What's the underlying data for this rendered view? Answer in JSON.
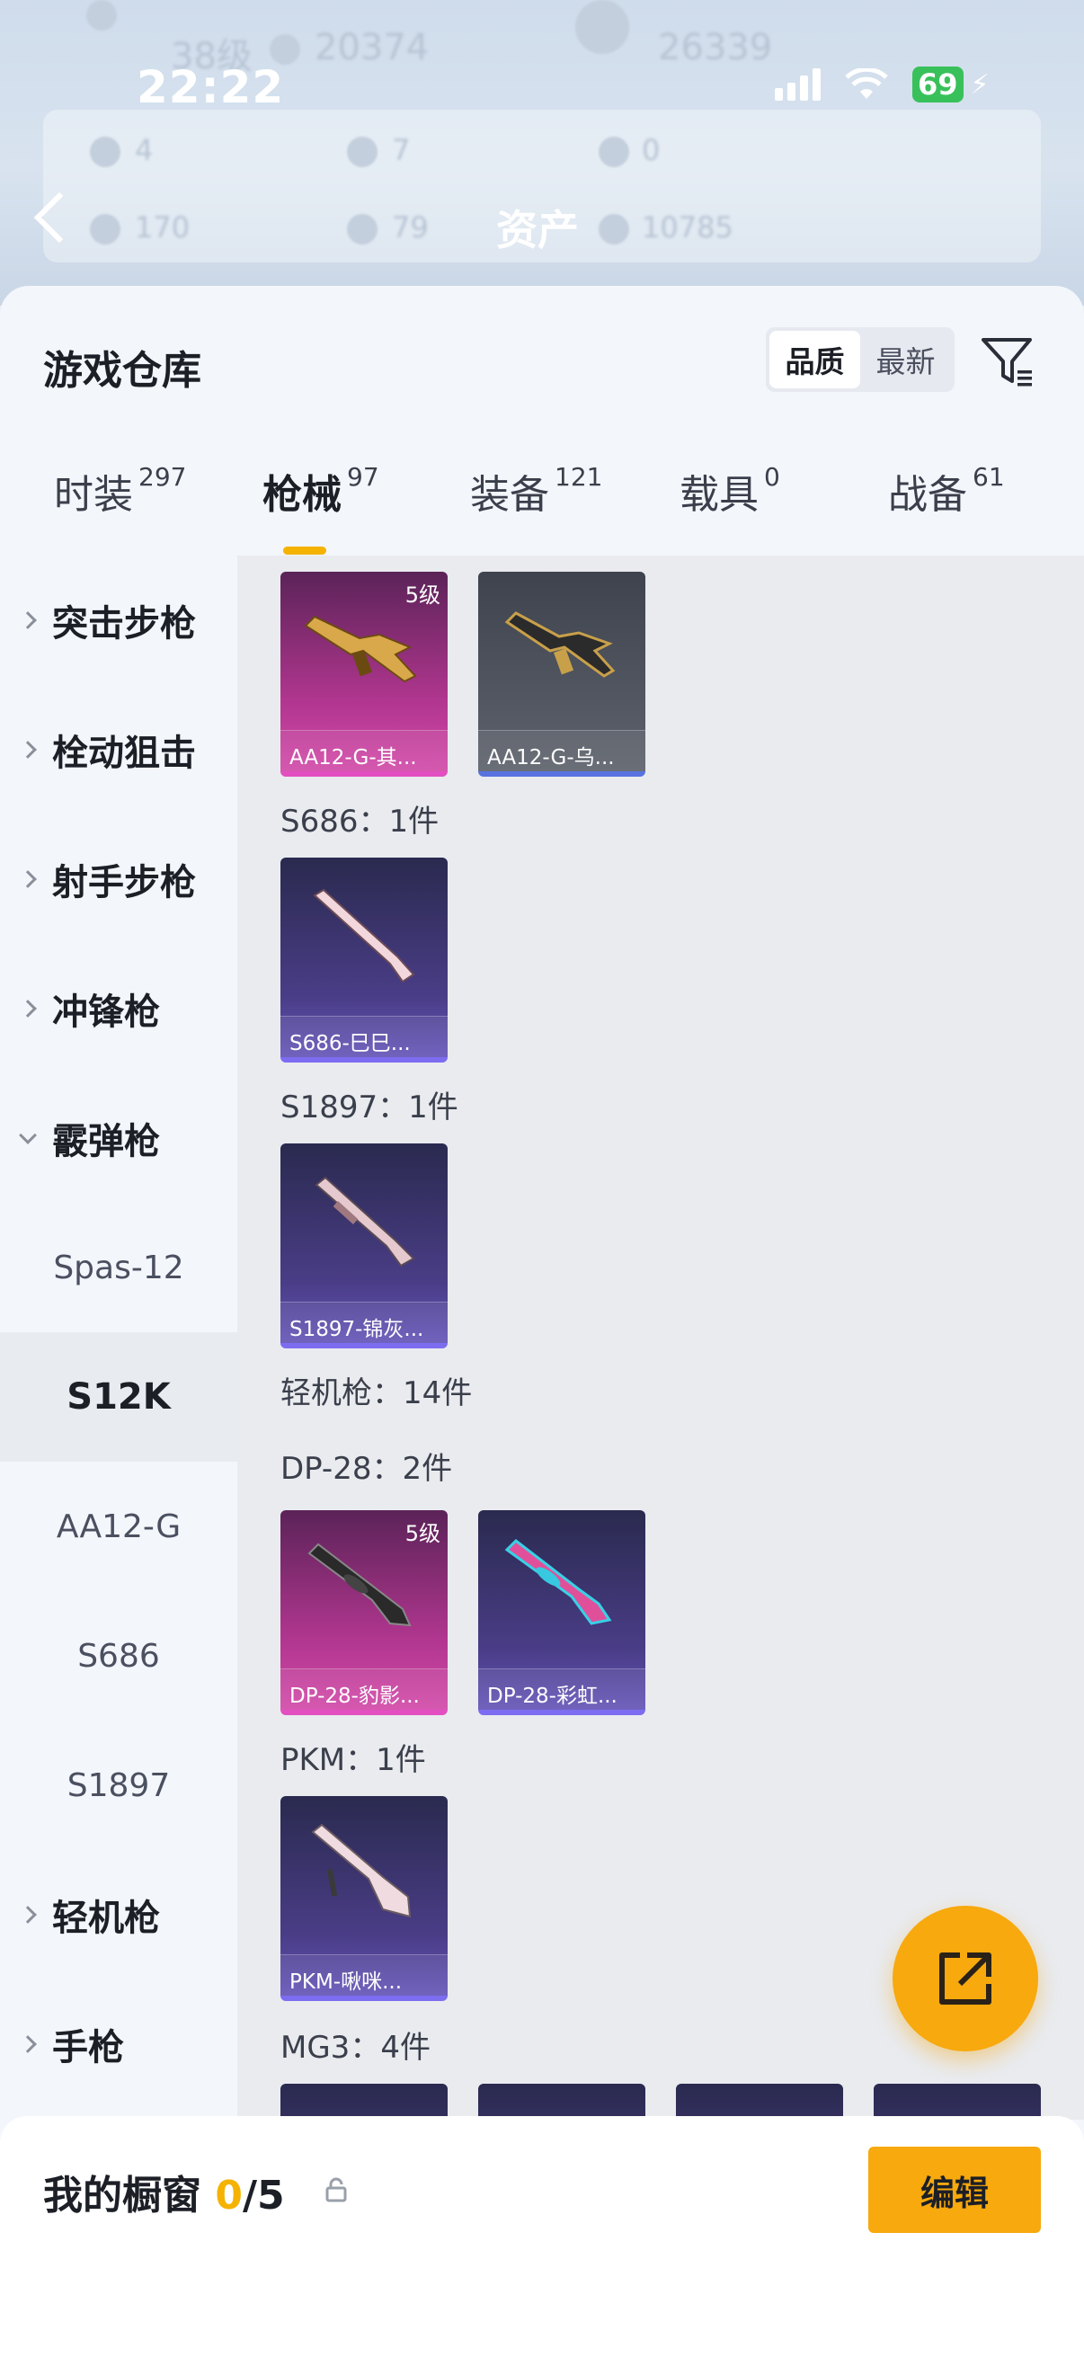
{
  "status_bar": {
    "time": "22:22",
    "battery": "69"
  },
  "header": {
    "title": "资产",
    "bg_stats": [
      "38级",
      "20374",
      "26339",
      "4",
      "7",
      "0",
      "170",
      "79",
      "10785"
    ]
  },
  "warehouse": {
    "title": "游戏仓库",
    "sort_options": [
      "品质",
      "最新"
    ],
    "active_sort": "品质",
    "tabs": [
      {
        "label": "时装",
        "count": "297"
      },
      {
        "label": "枪械",
        "count": "97"
      },
      {
        "label": "装备",
        "count": "121"
      },
      {
        "label": "载具",
        "count": "0"
      },
      {
        "label": "战备",
        "count": "61"
      }
    ],
    "active_tab": "枪械"
  },
  "sidebar": {
    "categories": [
      {
        "label": "突击步枪",
        "expanded": false
      },
      {
        "label": "栓动狙击",
        "expanded": false
      },
      {
        "label": "射手步枪",
        "expanded": false
      },
      {
        "label": "冲锋枪",
        "expanded": false
      },
      {
        "label": "霰弹枪",
        "expanded": true
      },
      {
        "label": "轻机枪",
        "expanded": false
      },
      {
        "label": "手枪",
        "expanded": false
      }
    ],
    "subitems": [
      "Spas-12",
      "S12K",
      "AA12-G",
      "S686",
      "S1897"
    ],
    "selected_sub": "S12K"
  },
  "content": {
    "top_cards": [
      {
        "name": "AA12-G-其...",
        "badge": "5级",
        "rarity": "pink"
      },
      {
        "name": "AA12-G-乌...",
        "badge": "",
        "rarity": "grey"
      }
    ],
    "groups": {
      "s686": {
        "label": "S686：1件",
        "cards": [
          {
            "name": "S686-巳巳..."
          }
        ]
      },
      "s1897": {
        "label": "S1897：1件",
        "cards": [
          {
            "name": "S1897-锦灰..."
          }
        ]
      },
      "lmg": {
        "label": "轻机枪：14件"
      },
      "dp28": {
        "label": "DP-28：2件",
        "cards": [
          {
            "name": "DP-28-豹影...",
            "badge": "5级"
          },
          {
            "name": "DP-28-彩虹..."
          }
        ]
      },
      "pkm": {
        "label": "PKM：1件",
        "cards": [
          {
            "name": "PKM-啾咪..."
          }
        ]
      },
      "mg3": {
        "label": "MG3：4件"
      }
    }
  },
  "showcase": {
    "title": "我的橱窗",
    "current": "0",
    "total": "/5",
    "edit_label": "编辑"
  },
  "colors": {
    "accent": "#f7a90d",
    "tab_underline": "#f5b200",
    "epic_pink": "#e24fc0",
    "legend_purple": "#7c6cf0"
  }
}
